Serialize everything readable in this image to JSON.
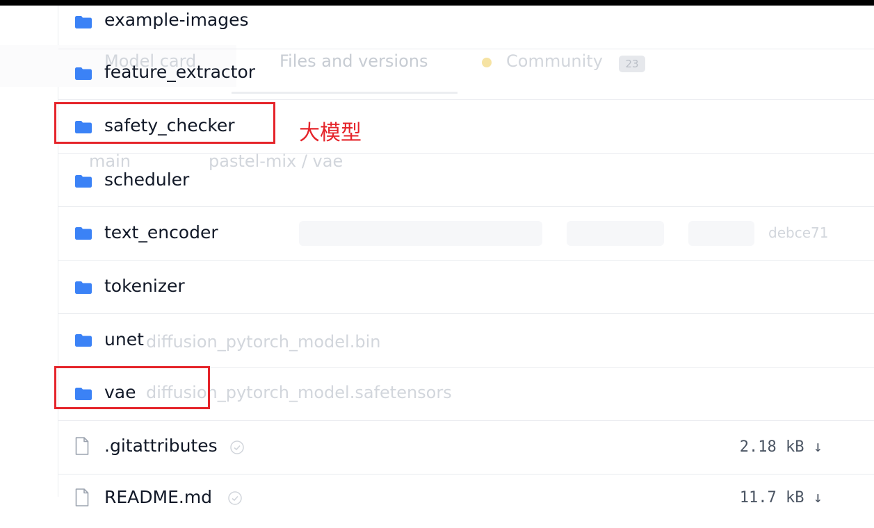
{
  "ghost": {
    "tab_model": "Model card",
    "tab_files": "Files and versions",
    "tab_community": "Community",
    "community_count": "23",
    "branch": "main",
    "path": "pastel-mix / vae",
    "commit": "debce71",
    "file_a": "diffusion_pytorch_model.bin",
    "file_b": "diffusion_pytorch_model.safetensors"
  },
  "files": [
    {
      "name": "example-images",
      "type": "folder"
    },
    {
      "name": "feature_extractor",
      "type": "folder"
    },
    {
      "name": "safety_checker",
      "type": "folder"
    },
    {
      "name": "scheduler",
      "type": "folder"
    },
    {
      "name": "text_encoder",
      "type": "folder"
    },
    {
      "name": "tokenizer",
      "type": "folder"
    },
    {
      "name": "unet",
      "type": "folder"
    },
    {
      "name": "vae",
      "type": "folder"
    },
    {
      "name": ".gitattributes",
      "type": "file",
      "size": "2.18 kB ↓"
    },
    {
      "name": "README.md",
      "type": "file",
      "size": "11.7 kB ↓"
    }
  ],
  "annotation": {
    "label": "大模型",
    "color": "#e5242a"
  },
  "colors": {
    "folder": "#3b82f6",
    "file": "#9ca3af",
    "text": "#111827"
  },
  "icons": {
    "folder": "folder-icon",
    "file": "file-icon",
    "verified": "verified-icon"
  }
}
